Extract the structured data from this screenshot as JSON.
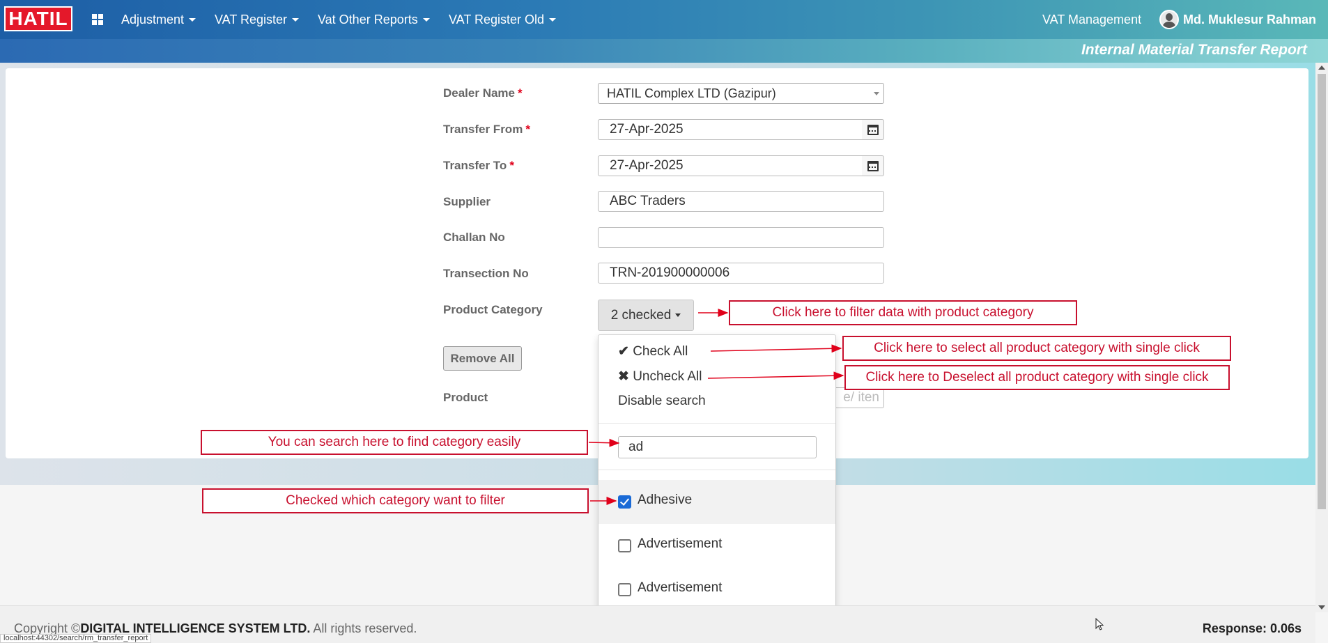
{
  "header": {
    "logo": "HATIL",
    "nav": [
      {
        "label": "Adjustment"
      },
      {
        "label": "VAT Register"
      },
      {
        "label": "Vat Other Reports"
      },
      {
        "label": "VAT Register Old"
      }
    ],
    "module": "VAT Management",
    "user": "Md. Muklesur Rahman"
  },
  "page_title": "Internal Material Transfer Report",
  "form": {
    "dealer_label": "Dealer Name",
    "dealer_value": "HATIL Complex LTD (Gazipur)",
    "from_label": "Transfer From",
    "from_value": "27-Apr-2025",
    "to_label": "Transfer To",
    "to_value": "27-Apr-2025",
    "supplier_label": "Supplier",
    "supplier_value": "ABC Traders",
    "challan_label": "Challan No",
    "challan_value": "",
    "transaction_label": "Transection No",
    "transaction_value": "TRN-201900000006",
    "category_label": "Product Category",
    "category_button": "2 checked",
    "remove_all": "Remove All",
    "product_label": "Product",
    "product_placeholder": "e/ iten",
    "required_mark": "*"
  },
  "dropdown": {
    "check_all": "Check All",
    "uncheck_all": "Uncheck All",
    "disable_search": "Disable search",
    "search_value": "ad",
    "options": [
      {
        "label": "Adhesive",
        "checked": true
      },
      {
        "label": "Advertisement",
        "checked": false
      },
      {
        "label": "Advertisement",
        "checked": false
      }
    ]
  },
  "annotations": {
    "filter": "Click here to filter data with product category",
    "select_all": "Click here to select all product category with single click",
    "deselect_all": "Click here to Deselect all product category with single click",
    "search": "You can search here to find category easily",
    "checked": "Checked which category want to filter"
  },
  "footer": {
    "copyright_prefix": "Copyright ©",
    "company": "DIGITAL INTELLIGENCE SYSTEM LTD.",
    "rights": " All rights reserved.",
    "response": "Response: 0.06s",
    "status_url": "localhost:44302/search/rm_transfer_report"
  },
  "colors": {
    "brand_red": "#e4182a",
    "annotation_red": "#c8102e",
    "checkbox_blue": "#1a6ad6"
  }
}
